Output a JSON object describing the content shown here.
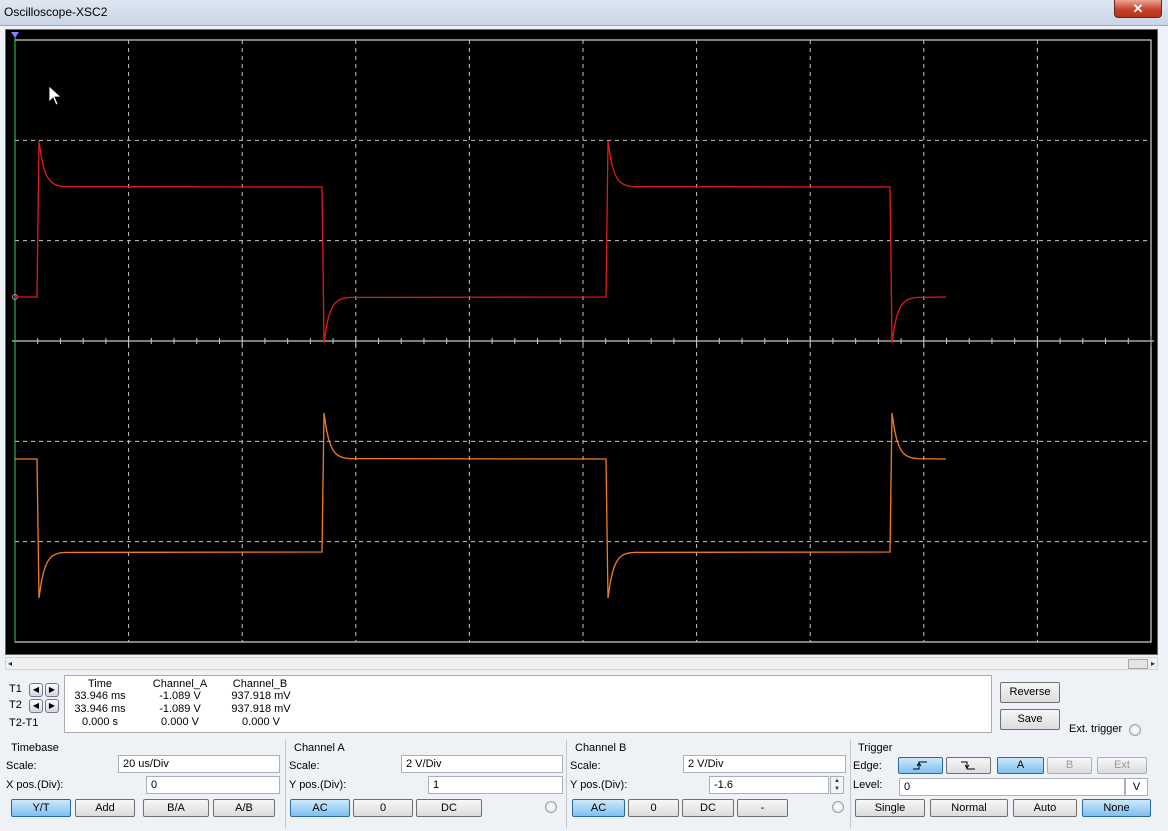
{
  "window": {
    "title": "Oscilloscope-XSC2",
    "close_label": "✕"
  },
  "screen": {
    "background": "#000000",
    "grid_color": "#c8c8c8",
    "channel_a_color": "#e01b1b",
    "channel_b_color": "#f07e1e",
    "cursor_color": "#2bd35a"
  },
  "cursors": {
    "rows": [
      {
        "label": "T1",
        "time": "33.946 ms",
        "channel_a": "-1.089 V",
        "channel_b": "937.918 mV"
      },
      {
        "label": "T2",
        "time": "33.946 ms",
        "channel_a": "-1.089 V",
        "channel_b": "937.918 mV"
      },
      {
        "label": "T2-T1",
        "time": "0.000 s",
        "channel_a": "0.000 V",
        "channel_b": "0.000 V"
      }
    ],
    "headers": {
      "time": "Time",
      "channel_a": "Channel_A",
      "channel_b": "Channel_B"
    },
    "left_icon": "arrow-left-icon",
    "right_icon": "arrow-right-icon",
    "reverse_label": "Reverse",
    "save_label": "Save",
    "ext_trigger_label": "Ext. trigger"
  },
  "timebase": {
    "title": "Timebase",
    "scale_label": "Scale:",
    "scale_value": "20 us/Div",
    "xpos_label": "X pos.(Div):",
    "xpos_value": "0",
    "buttons": [
      "Y/T",
      "Add",
      "B/A",
      "A/B"
    ],
    "active": "Y/T"
  },
  "channel_a": {
    "title": "Channel A",
    "scale_label": "Scale:",
    "scale_value": "2  V/Div",
    "ypos_label": "Y pos.(Div):",
    "ypos_value": "1",
    "buttons": [
      "AC",
      "0",
      "DC"
    ],
    "active": "AC"
  },
  "channel_b": {
    "title": "Channel B",
    "scale_label": "Scale:",
    "scale_value": "2  V/Div",
    "ypos_label": "Y pos.(Div):",
    "ypos_value": "-1.6",
    "buttons": [
      "AC",
      "0",
      "DC",
      "-"
    ],
    "active": "AC"
  },
  "trigger": {
    "title": "Trigger",
    "edge_label": "Edge:",
    "level_label": "Level:",
    "level_value": "0",
    "level_unit": "V",
    "edge_buttons": [
      "rising-edge-icon",
      "falling-edge-icon"
    ],
    "source_buttons": [
      "A",
      "B",
      "Ext"
    ],
    "source_active": "A",
    "mode_buttons": [
      "Single",
      "Normal",
      "Auto",
      "None"
    ],
    "mode_active": "None"
  }
}
